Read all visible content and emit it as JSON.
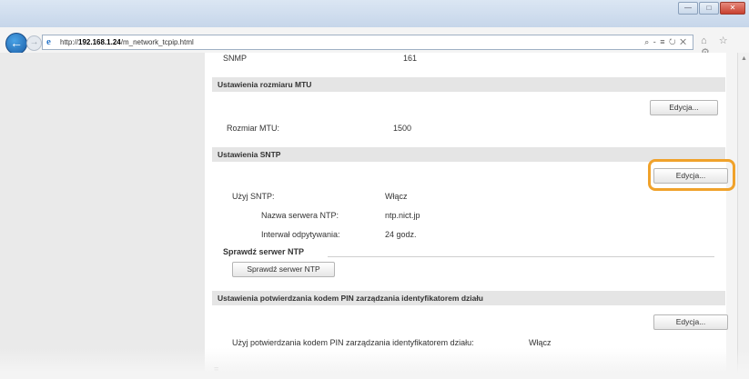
{
  "browser": {
    "url_prefix": "http://",
    "url_host": "192.168.1.24",
    "url_path": "/m_network_tcpip.html",
    "address_tools": "⌕ - ≡ ↻ ✕",
    "nav_icons": "⌂ ☆ ⚙",
    "window_buttons": [
      "—",
      "□",
      "✕"
    ]
  },
  "page": {
    "snmp_label": "SNMP",
    "snmp_value": "161",
    "mtu": {
      "section_title": "Ustawienia rozmiaru MTU",
      "edit_label": "Edycja...",
      "size_label": "Rozmiar MTU:",
      "size_value": "1500"
    },
    "sntp": {
      "section_title": "Ustawienia SNTP",
      "edit_label": "Edycja...",
      "use_label": "Użyj SNTP:",
      "use_value": "Włącz",
      "server_label": "Nazwa serwera NTP:",
      "server_value": "ntp.nict.jp",
      "interval_label": "Interwał odpytywania:",
      "interval_value": "24 godz.",
      "check_heading": "Sprawdź serwer NTP",
      "check_button": "Sprawdź serwer NTP"
    },
    "pin": {
      "section_title": "Ustawienia potwierdzania kodem PIN zarządzania identyfikatorem działu",
      "edit_label": "Edycja...",
      "use_label": "Użyj potwierdzania kodem PIN zarządzania identyfikatorem działu:",
      "use_value": "Włącz"
    },
    "trailing_marker": "≡"
  },
  "colors": {
    "highlight": "#f0a22b",
    "section_bg": "#e5e5e5",
    "link": "#2a76c9"
  }
}
